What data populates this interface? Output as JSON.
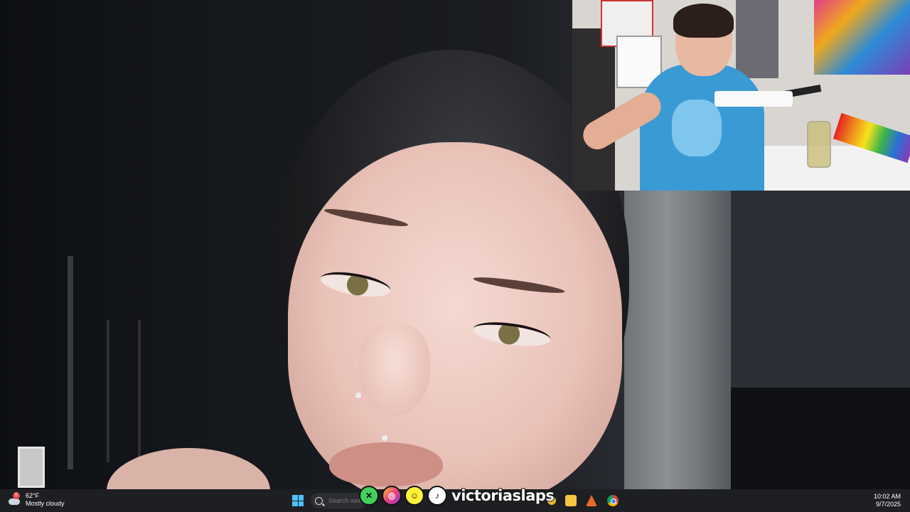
{
  "weather": {
    "temp": "62°F",
    "condition": "Mostly cloudy",
    "alert_count": "5"
  },
  "taskbar": {
    "search_placeholder": "Search web"
  },
  "overlay": {
    "handle": "victoriaslaps"
  },
  "clock": {
    "time": "10:02 AM",
    "date": "9/7/2025"
  },
  "icons": {
    "start": "windows-start-icon",
    "search": "search-icon",
    "x": "x-icon",
    "instagram": "instagram-icon",
    "snapchat": "snapchat-icon",
    "tiktok": "tiktok-icon",
    "folder": "file-explorer-icon",
    "app": "app-icon",
    "chrome": "chrome-icon"
  },
  "colors": {
    "taskbar_bg": "#1e1f22",
    "accent": "#4cc2ff"
  }
}
